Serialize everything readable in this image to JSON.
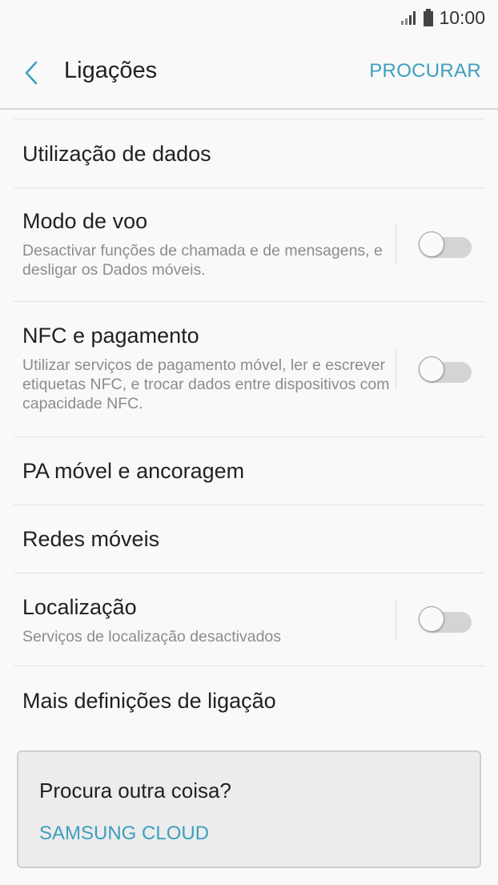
{
  "status_bar": {
    "time": "10:00",
    "icons": [
      "signal-icon",
      "battery-icon"
    ]
  },
  "header": {
    "title": "Ligações",
    "action_label": "PROCURAR",
    "back_icon": "chevron-left-icon"
  },
  "settings": [
    {
      "title": "Utilização de dados"
    },
    {
      "title": "Modo de voo",
      "subtitle": "Desactivar funções de chamada e de mensagens, e desligar os Dados móveis.",
      "toggle": false
    },
    {
      "title": "NFC e pagamento",
      "subtitle": "Utilizar serviços de pagamento móvel, ler e escrever etiquetas NFC, e trocar dados entre dispositivos com capacidade NFC.",
      "toggle": false
    },
    {
      "title": "PA móvel e ancoragem"
    },
    {
      "title": "Redes móveis"
    },
    {
      "title": "Localização",
      "subtitle": "Serviços de localização desactivados",
      "toggle": false
    },
    {
      "title": "Mais definições de ligação"
    }
  ],
  "suggestion": {
    "title": "Procura outra coisa?",
    "link": "SAMSUNG CLOUD"
  },
  "colors": {
    "accent": "#3d9fbf",
    "background": "#f9f9f9",
    "card": "#ececec"
  }
}
